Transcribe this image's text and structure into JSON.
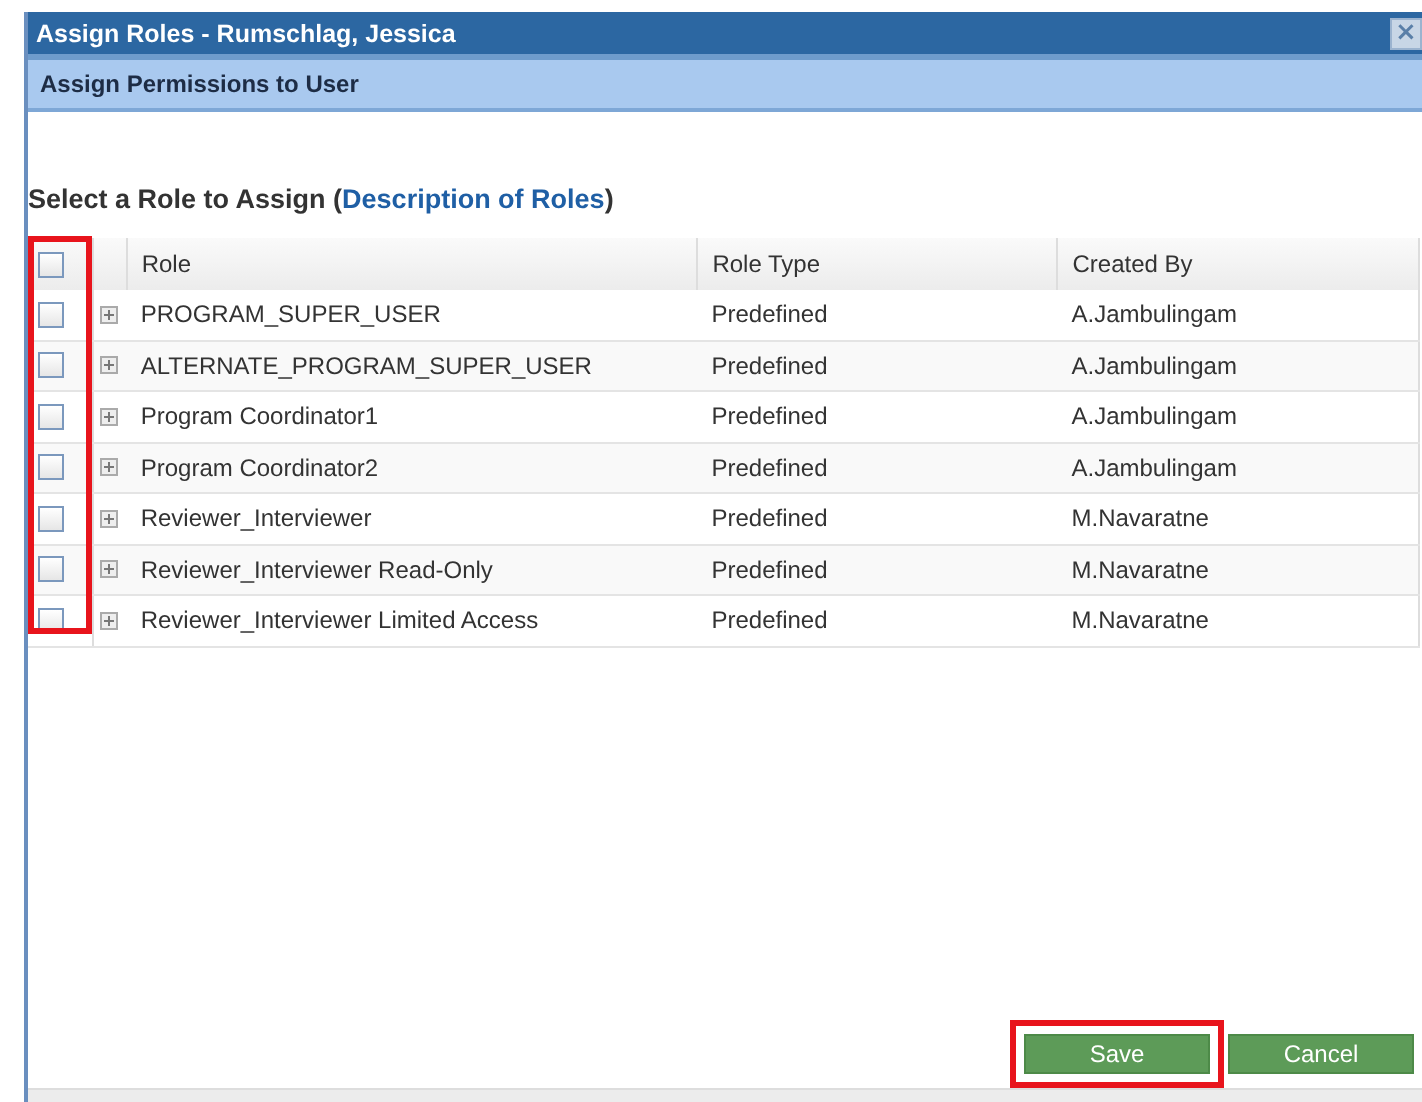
{
  "window": {
    "title": "Assign Roles - Rumschlag, Jessica",
    "close_icon": "×"
  },
  "section_header": "Assign Permissions to User",
  "heading": {
    "text": "Select a Role to Assign",
    "open_paren": "(",
    "link": "Description of Roles",
    "close_paren": ")"
  },
  "table": {
    "select_all_checked": false,
    "checkbox_column_highlighted": true,
    "columns": [
      "Role",
      "Role Type",
      "Created By"
    ],
    "rows": [
      {
        "checked": false,
        "cells": [
          "PROGRAM_SUPER_USER",
          "Predefined",
          "A.Jambulingam"
        ]
      },
      {
        "checked": false,
        "cells": [
          "ALTERNATE_PROGRAM_SUPER_USER",
          "Predefined",
          "A.Jambulingam"
        ]
      },
      {
        "checked": false,
        "cells": [
          "Program Coordinator1",
          "Predefined",
          "A.Jambulingam"
        ]
      },
      {
        "checked": false,
        "cells": [
          "Program Coordinator2",
          "Predefined",
          "A.Jambulingam"
        ]
      },
      {
        "checked": false,
        "cells": [
          "Reviewer_Interviewer",
          "Predefined",
          "M.Navaratne"
        ]
      },
      {
        "checked": false,
        "cells": [
          "Reviewer_Interviewer Read-Only",
          "Predefined",
          "M.Navaratne"
        ]
      },
      {
        "checked": false,
        "cells": [
          "Reviewer_Interviewer Limited Access",
          "Predefined",
          "M.Navaratne"
        ]
      }
    ]
  },
  "buttons": [
    {
      "label": "Save",
      "highlighted": true
    },
    {
      "label": "Cancel",
      "highlighted": false
    }
  ]
}
